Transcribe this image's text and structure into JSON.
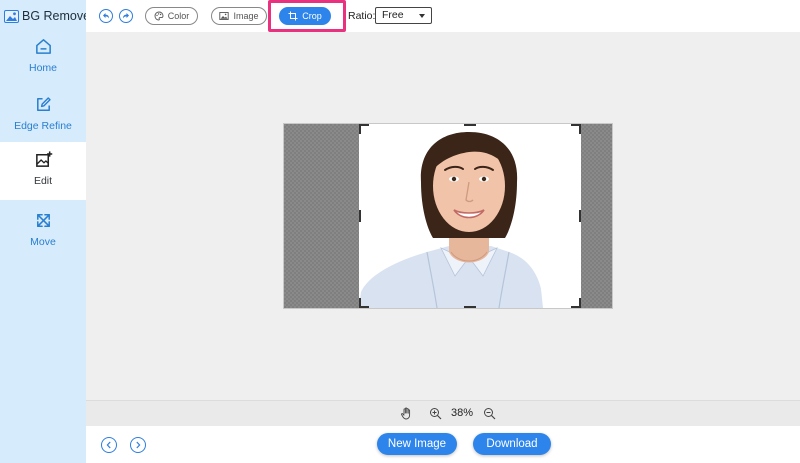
{
  "app": {
    "title": "BG Remover"
  },
  "sidebar": {
    "items": [
      {
        "label": "Home",
        "icon": "home-icon",
        "active": false
      },
      {
        "label": "Edge Refine",
        "icon": "edit-pen-icon",
        "active": false
      },
      {
        "label": "Edit",
        "icon": "image-edit-icon",
        "active": true
      },
      {
        "label": "Move",
        "icon": "move-arrows-icon",
        "active": false
      }
    ]
  },
  "toolbar": {
    "undo_icon": "undo-icon",
    "redo_icon": "redo-icon",
    "tools": [
      {
        "label": "Color",
        "icon": "palette-icon",
        "active": false
      },
      {
        "label": "Image",
        "icon": "image-icon",
        "active": false
      },
      {
        "label": "Crop",
        "icon": "crop-icon",
        "active": true
      }
    ],
    "ratio_label": "Ratio:",
    "ratio_value": "Free"
  },
  "zoom": {
    "level": "38%",
    "hand_icon": "hand-icon",
    "zoom_in_icon": "zoom-in-icon",
    "zoom_out_icon": "zoom-out-icon"
  },
  "bottom": {
    "prev_icon": "chevron-left-icon",
    "next_icon": "chevron-right-icon",
    "new_image_label": "New Image",
    "download_label": "Download"
  },
  "colors": {
    "accent": "#2d84ea",
    "sidebar_bg": "#d6ebfb",
    "highlight": "#e8317f",
    "canvas_bg": "#efefef"
  }
}
